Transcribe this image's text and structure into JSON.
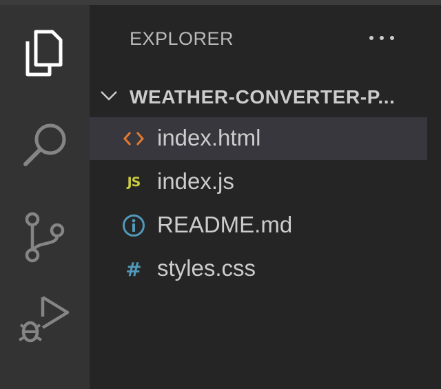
{
  "activity_bar": {
    "items": [
      {
        "name": "explorer",
        "icon": "files-icon",
        "active": true
      },
      {
        "name": "search",
        "icon": "search-icon",
        "active": false
      },
      {
        "name": "source-control",
        "icon": "source-control-icon",
        "active": false
      },
      {
        "name": "run-debug",
        "icon": "run-debug-icon",
        "active": false
      }
    ]
  },
  "sidebar": {
    "title": "EXPLORER",
    "more_actions_icon": "ellipsis-icon",
    "folder": {
      "name": "WEATHER-CONVERTER-P...",
      "expanded": true
    },
    "files": [
      {
        "name": "index.html",
        "icon": "html-icon",
        "icon_color": "#e37933",
        "selected": true
      },
      {
        "name": "index.js",
        "icon": "js-icon",
        "icon_color": "#cbcb41",
        "selected": false
      },
      {
        "name": "README.md",
        "icon": "info-icon",
        "icon_color": "#519aba",
        "selected": false
      },
      {
        "name": "styles.css",
        "icon": "css-icon",
        "icon_color": "#519aba",
        "selected": false
      }
    ]
  },
  "colors": {
    "activity_bar_bg": "#333333",
    "sidebar_bg": "#252526",
    "selected_row_bg": "#37373d",
    "active_icon": "#ffffff",
    "inactive_icon": "#858585"
  }
}
